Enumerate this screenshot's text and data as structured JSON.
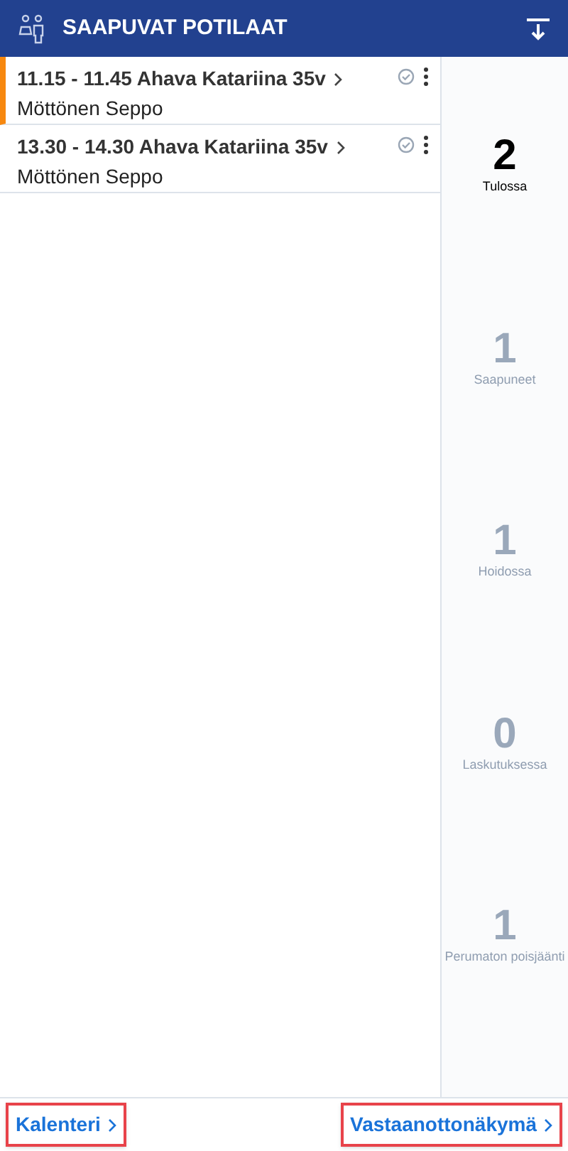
{
  "header": {
    "title": "SAAPUVAT POTILAAT"
  },
  "appointments": [
    {
      "title": "11.15 - 11.45 Ahava Katariina 35v",
      "patient": "Möttönen Seppo",
      "selected": true
    },
    {
      "title": "13.30 - 14.30 Ahava Katariina 35v",
      "patient": "Möttönen Seppo",
      "selected": false
    }
  ],
  "stats": [
    {
      "count": "2",
      "label": "Tulossa",
      "selected": true
    },
    {
      "count": "1",
      "label": "Saapuneet",
      "selected": false
    },
    {
      "count": "1",
      "label": "Hoidossa",
      "selected": false
    },
    {
      "count": "0",
      "label": "Laskutuksessa",
      "selected": false
    },
    {
      "count": "1",
      "label": "Perumaton poisjäänti",
      "selected": false
    }
  ],
  "footer_links": [
    {
      "label": "Kalenteri"
    },
    {
      "label": "Vastaanottonäkymä"
    }
  ]
}
